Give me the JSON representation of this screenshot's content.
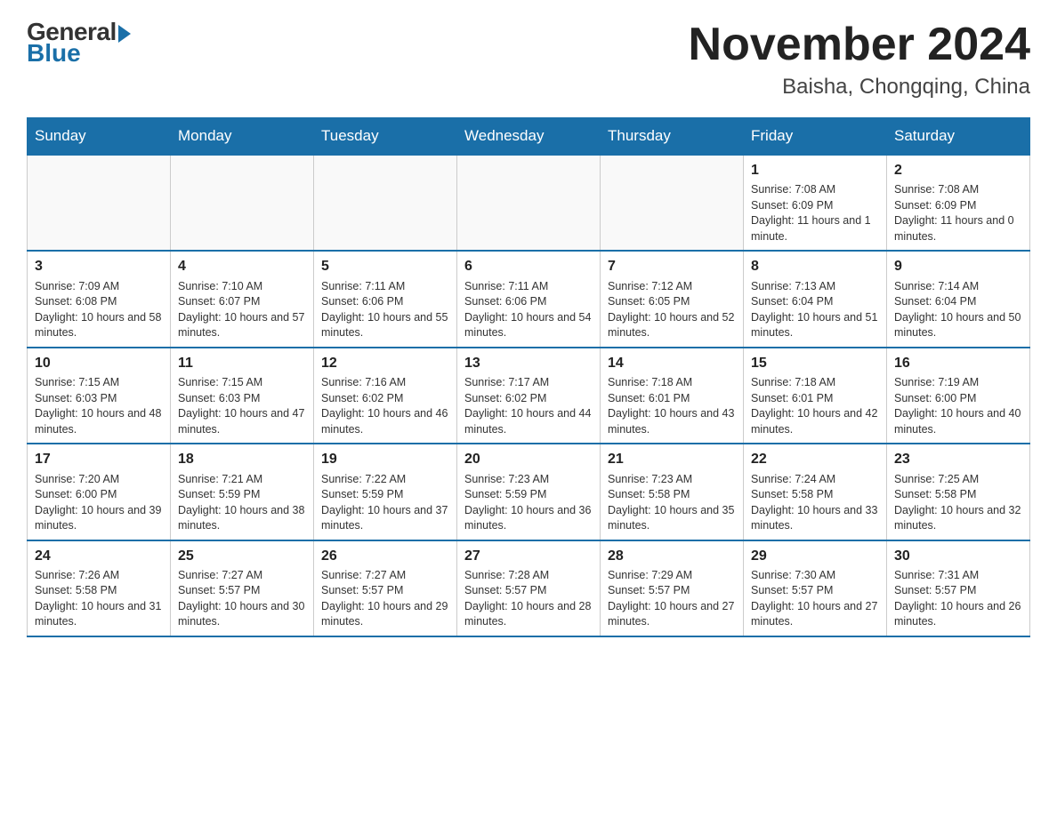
{
  "header": {
    "logo": {
      "general": "General",
      "blue": "Blue"
    },
    "title": "November 2024",
    "location": "Baisha, Chongqing, China"
  },
  "calendar": {
    "days_of_week": [
      "Sunday",
      "Monday",
      "Tuesday",
      "Wednesday",
      "Thursday",
      "Friday",
      "Saturday"
    ],
    "weeks": [
      [
        {
          "day": "",
          "info": ""
        },
        {
          "day": "",
          "info": ""
        },
        {
          "day": "",
          "info": ""
        },
        {
          "day": "",
          "info": ""
        },
        {
          "day": "",
          "info": ""
        },
        {
          "day": "1",
          "info": "Sunrise: 7:08 AM\nSunset: 6:09 PM\nDaylight: 11 hours and 1 minute."
        },
        {
          "day": "2",
          "info": "Sunrise: 7:08 AM\nSunset: 6:09 PM\nDaylight: 11 hours and 0 minutes."
        }
      ],
      [
        {
          "day": "3",
          "info": "Sunrise: 7:09 AM\nSunset: 6:08 PM\nDaylight: 10 hours and 58 minutes."
        },
        {
          "day": "4",
          "info": "Sunrise: 7:10 AM\nSunset: 6:07 PM\nDaylight: 10 hours and 57 minutes."
        },
        {
          "day": "5",
          "info": "Sunrise: 7:11 AM\nSunset: 6:06 PM\nDaylight: 10 hours and 55 minutes."
        },
        {
          "day": "6",
          "info": "Sunrise: 7:11 AM\nSunset: 6:06 PM\nDaylight: 10 hours and 54 minutes."
        },
        {
          "day": "7",
          "info": "Sunrise: 7:12 AM\nSunset: 6:05 PM\nDaylight: 10 hours and 52 minutes."
        },
        {
          "day": "8",
          "info": "Sunrise: 7:13 AM\nSunset: 6:04 PM\nDaylight: 10 hours and 51 minutes."
        },
        {
          "day": "9",
          "info": "Sunrise: 7:14 AM\nSunset: 6:04 PM\nDaylight: 10 hours and 50 minutes."
        }
      ],
      [
        {
          "day": "10",
          "info": "Sunrise: 7:15 AM\nSunset: 6:03 PM\nDaylight: 10 hours and 48 minutes."
        },
        {
          "day": "11",
          "info": "Sunrise: 7:15 AM\nSunset: 6:03 PM\nDaylight: 10 hours and 47 minutes."
        },
        {
          "day": "12",
          "info": "Sunrise: 7:16 AM\nSunset: 6:02 PM\nDaylight: 10 hours and 46 minutes."
        },
        {
          "day": "13",
          "info": "Sunrise: 7:17 AM\nSunset: 6:02 PM\nDaylight: 10 hours and 44 minutes."
        },
        {
          "day": "14",
          "info": "Sunrise: 7:18 AM\nSunset: 6:01 PM\nDaylight: 10 hours and 43 minutes."
        },
        {
          "day": "15",
          "info": "Sunrise: 7:18 AM\nSunset: 6:01 PM\nDaylight: 10 hours and 42 minutes."
        },
        {
          "day": "16",
          "info": "Sunrise: 7:19 AM\nSunset: 6:00 PM\nDaylight: 10 hours and 40 minutes."
        }
      ],
      [
        {
          "day": "17",
          "info": "Sunrise: 7:20 AM\nSunset: 6:00 PM\nDaylight: 10 hours and 39 minutes."
        },
        {
          "day": "18",
          "info": "Sunrise: 7:21 AM\nSunset: 5:59 PM\nDaylight: 10 hours and 38 minutes."
        },
        {
          "day": "19",
          "info": "Sunrise: 7:22 AM\nSunset: 5:59 PM\nDaylight: 10 hours and 37 minutes."
        },
        {
          "day": "20",
          "info": "Sunrise: 7:23 AM\nSunset: 5:59 PM\nDaylight: 10 hours and 36 minutes."
        },
        {
          "day": "21",
          "info": "Sunrise: 7:23 AM\nSunset: 5:58 PM\nDaylight: 10 hours and 35 minutes."
        },
        {
          "day": "22",
          "info": "Sunrise: 7:24 AM\nSunset: 5:58 PM\nDaylight: 10 hours and 33 minutes."
        },
        {
          "day": "23",
          "info": "Sunrise: 7:25 AM\nSunset: 5:58 PM\nDaylight: 10 hours and 32 minutes."
        }
      ],
      [
        {
          "day": "24",
          "info": "Sunrise: 7:26 AM\nSunset: 5:58 PM\nDaylight: 10 hours and 31 minutes."
        },
        {
          "day": "25",
          "info": "Sunrise: 7:27 AM\nSunset: 5:57 PM\nDaylight: 10 hours and 30 minutes."
        },
        {
          "day": "26",
          "info": "Sunrise: 7:27 AM\nSunset: 5:57 PM\nDaylight: 10 hours and 29 minutes."
        },
        {
          "day": "27",
          "info": "Sunrise: 7:28 AM\nSunset: 5:57 PM\nDaylight: 10 hours and 28 minutes."
        },
        {
          "day": "28",
          "info": "Sunrise: 7:29 AM\nSunset: 5:57 PM\nDaylight: 10 hours and 27 minutes."
        },
        {
          "day": "29",
          "info": "Sunrise: 7:30 AM\nSunset: 5:57 PM\nDaylight: 10 hours and 27 minutes."
        },
        {
          "day": "30",
          "info": "Sunrise: 7:31 AM\nSunset: 5:57 PM\nDaylight: 10 hours and 26 minutes."
        }
      ]
    ]
  }
}
